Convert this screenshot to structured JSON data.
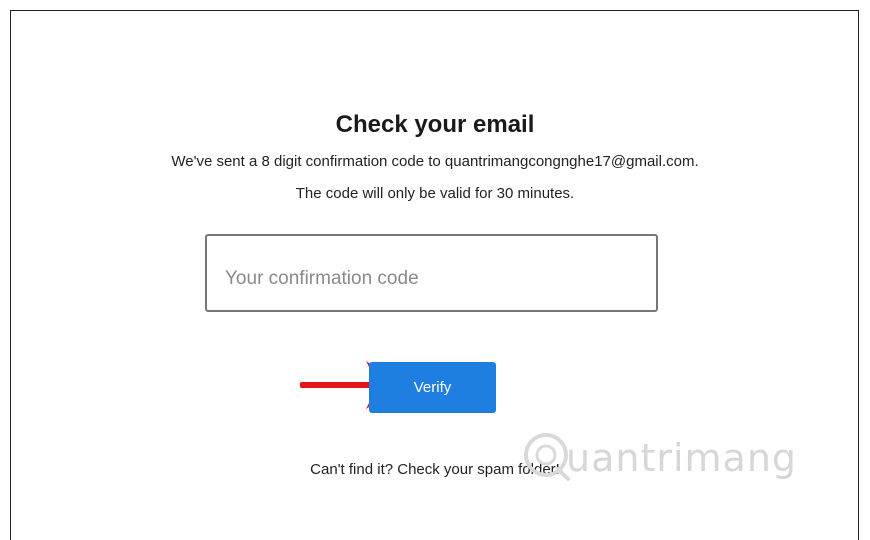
{
  "heading": "Check your email",
  "message": {
    "line1": "We've sent a 8 digit confirmation code to quantrimangcongnghe17@gmail.com.",
    "line2": "The code will only be valid for 30 minutes."
  },
  "code_input": {
    "placeholder": "Your confirmation code",
    "value": ""
  },
  "verify_button": {
    "label": "Verify",
    "color": "#1f7fe0"
  },
  "help": {
    "spam_text": "Can't find it? Check your spam folder!"
  },
  "annotation": {
    "arrow_color": "#e8141c",
    "arrow_icon": "pointer-arrow"
  },
  "watermark": {
    "text": "uantrimang"
  }
}
